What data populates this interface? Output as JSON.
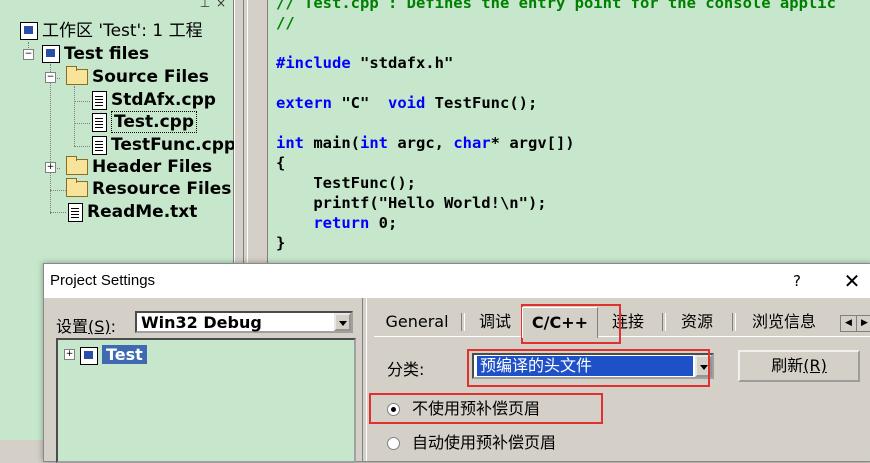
{
  "workspace": {
    "title": "工作区 'Test': 1 工程",
    "project": "Test files",
    "folders": {
      "source": "Source Files",
      "header": "Header Files",
      "resource": "Resource Files"
    },
    "source_files": [
      "StdAfx.cpp",
      "Test.cpp",
      "TestFunc.cpp"
    ],
    "readme": "ReadMe.txt",
    "selected_file": "Test.cpp"
  },
  "editor": {
    "lines": [
      {
        "text": "// Test.cpp : Defines the entry point for the console applic",
        "kind": "comment"
      },
      {
        "text": "//",
        "kind": "comment"
      },
      {
        "text": "",
        "kind": "plain"
      },
      {
        "text": "#include \"stdafx.h\"",
        "kind": "include"
      },
      {
        "text": "",
        "kind": "plain"
      },
      {
        "text": "extern \"C\"  void TestFunc();",
        "kind": "extern"
      },
      {
        "text": "",
        "kind": "plain"
      },
      {
        "text": "int main(int argc, char* argv[])",
        "kind": "main"
      },
      {
        "text": "{",
        "kind": "plain"
      },
      {
        "text": "    TestFunc();",
        "kind": "plain"
      },
      {
        "text": "    printf(\"Hello World!\\n\");",
        "kind": "plain"
      },
      {
        "text": "    return 0;",
        "kind": "return"
      },
      {
        "text": "}",
        "kind": "plain"
      }
    ]
  },
  "dialog": {
    "title": "Project Settings",
    "help": "?",
    "close": "✕",
    "settings_label": "设置",
    "settings_accel": "(S)",
    "settings_colon": ":",
    "config_value": "Win32 Debug",
    "tree_node": "Test",
    "tabs": [
      "General",
      "调试",
      "C/C++",
      "连接",
      "资源",
      "浏览信息"
    ],
    "active_tab": "C/C++",
    "category_label": "分类:",
    "category_value": "预编译的头文件",
    "refresh_label": "刷新",
    "refresh_accel": "(R)",
    "radio_options": [
      {
        "label": "不使用预补偿页眉",
        "checked": true
      },
      {
        "label": "自动使用预补偿页眉",
        "checked": false
      }
    ]
  },
  "colors": {
    "highlight_box": "#e03030",
    "selection": "#1e50c8",
    "editor_bg": "#c7e7cc"
  }
}
